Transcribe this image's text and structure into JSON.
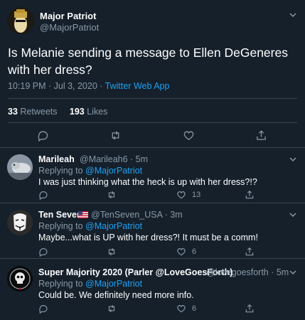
{
  "main_tweet": {
    "author_name": "Major Patriot",
    "author_handle": "@MajorPatriot",
    "text": "Is Melanie sending a message to  Ellen DeGeneres with her dress?",
    "time": "10:19 PM · Jul 3, 2020 · ",
    "source": "Twitter Web App",
    "retweets_count": "33",
    "retweets_label": "Retweets",
    "likes_count": "193",
    "likes_label": "Likes"
  },
  "replies": [
    {
      "author_name": "Marileah",
      "author_handle": "@Marileah6 · 5m",
      "replying_prefix": "Replying to ",
      "replying_to": "@MajorPatriot",
      "text": "I was just thinking what the heck is up with her dress?!?",
      "like_count": "13"
    },
    {
      "author_name": "Ten Seven",
      "author_handle": "@TenSeven_USA · 3m",
      "replying_prefix": "Replying to ",
      "replying_to": "@MajorPatriot",
      "text": "Maybe...what is UP with her dress?! It must be a comm!",
      "like_count": "6"
    },
    {
      "author_name": "Super Majority 2020 (Parler @LoveGoesForth)",
      "author_handle": "@lovegoesforth · 5m",
      "replying_prefix": "Replying to ",
      "replying_to": "@MajorPatriot",
      "text": "Could be. We definitely need more info.",
      "like_count": "6"
    }
  ],
  "icons": [
    "chevron-down-icon",
    "reply-icon",
    "retweet-icon",
    "like-icon",
    "share-icon",
    "us-flag-icon"
  ],
  "colors": {
    "background": "#15202b",
    "divider": "#38444d",
    "secondary_text": "#8899a6",
    "accent": "#1da1f2"
  }
}
